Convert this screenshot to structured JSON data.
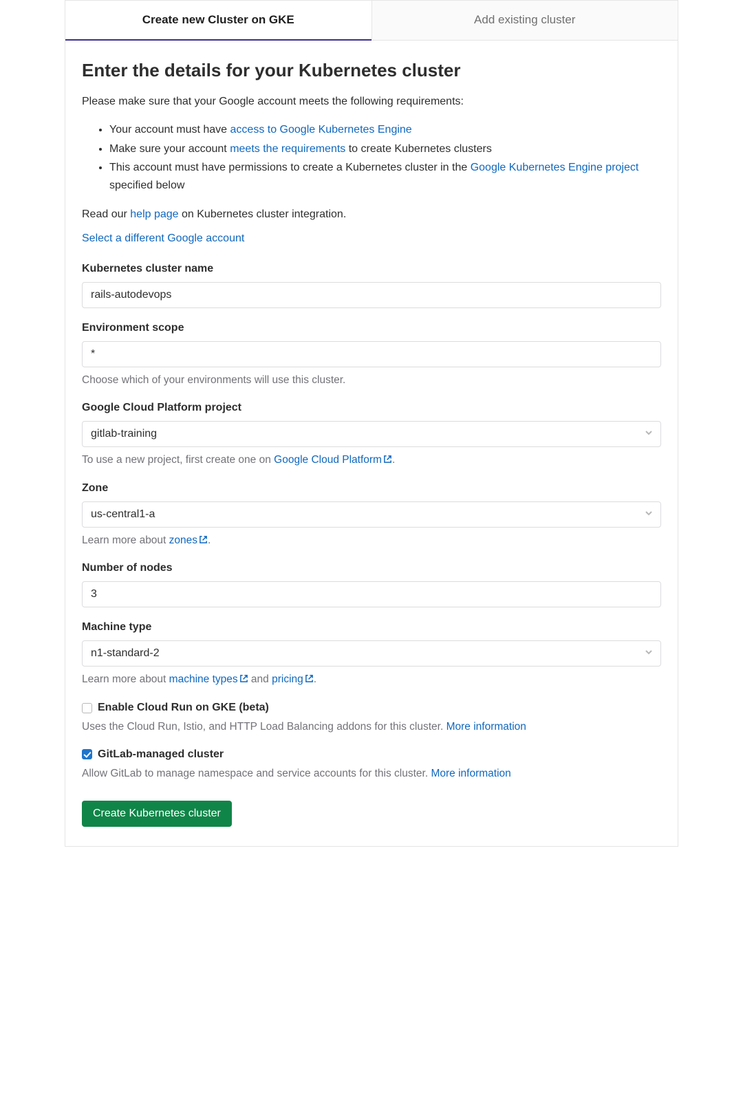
{
  "tabs": {
    "create": "Create new Cluster on GKE",
    "add": "Add existing cluster"
  },
  "heading": "Enter the details for your Kubernetes cluster",
  "intro": "Please make sure that your Google account meets the following requirements:",
  "reqs": {
    "r1a": "Your account must have ",
    "r1_link": "access to Google Kubernetes Engine",
    "r2a": "Make sure your account ",
    "r2_link": "meets the requirements",
    "r2b": " to create Kubernetes clusters",
    "r3a": "This account must have permissions to create a Kubernetes cluster in the ",
    "r3_link": "Google Kubernetes Engine project",
    "r3b": " specified below"
  },
  "read1": "Read our ",
  "read_link": "help page",
  "read2": " on Kubernetes cluster integration.",
  "select_account": "Select a different Google account",
  "fields": {
    "cluster_name_label": "Kubernetes cluster name",
    "cluster_name_value": "rails-autodevops",
    "env_scope_label": "Environment scope",
    "env_scope_value": "*",
    "env_scope_help": "Choose which of your environments will use this cluster.",
    "gcp_project_label": "Google Cloud Platform project",
    "gcp_project_value": "gitlab-training",
    "gcp_help1": "To use a new project, first create one on ",
    "gcp_help_link": "Google Cloud Platform",
    "gcp_help2": ".",
    "zone_label": "Zone",
    "zone_value": "us-central1-a",
    "zone_help1": "Learn more about ",
    "zone_help_link": "zones",
    "zone_help2": ".",
    "nodes_label": "Number of nodes",
    "nodes_value": "3",
    "machine_label": "Machine type",
    "machine_value": "n1-standard-2",
    "machine_help1": "Learn more about ",
    "machine_help_link1": "machine types",
    "machine_help_mid": " and ",
    "machine_help_link2": "pricing",
    "machine_help2": "."
  },
  "check1": {
    "label": "Enable Cloud Run on GKE (beta)",
    "help": "Uses the Cloud Run, Istio, and HTTP Load Balancing addons for this cluster. ",
    "more": "More information"
  },
  "check2": {
    "label": "GitLab-managed cluster",
    "help": "Allow GitLab to manage namespace and service accounts for this cluster. ",
    "more": "More information"
  },
  "submit": "Create Kubernetes cluster"
}
